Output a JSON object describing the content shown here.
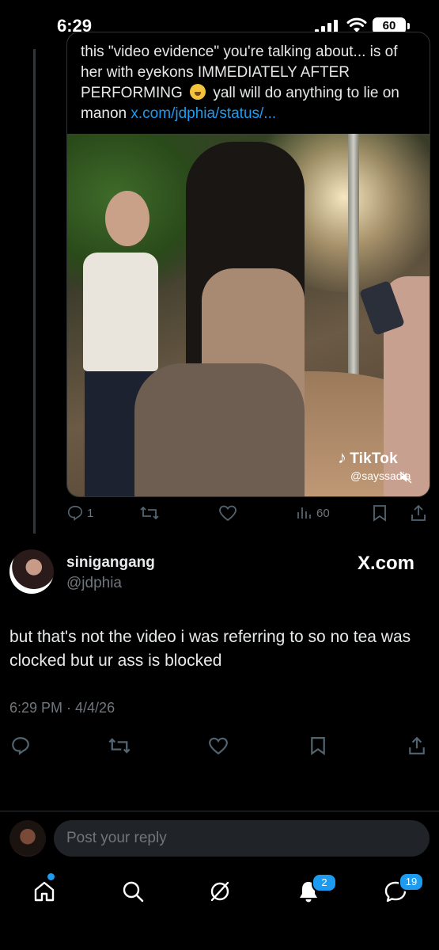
{
  "status_bar": {
    "time": "6:29",
    "battery": "60"
  },
  "quoted_tweet": {
    "text_before_emoji": "this \"video evidence\" you're talking about... is of her with eyekons IMMEDIATELY AFTER PERFORMING",
    "text_after_emoji": "yall will do anything to lie on manon",
    "link": "x.com/jdphia/status/...",
    "media": {
      "watermark": "TikTok",
      "watermark_handle": "@sayssadia"
    },
    "actions": {
      "reply_count": "1",
      "retweet_count": "",
      "like_count": "",
      "views_count": "60"
    }
  },
  "tweet": {
    "display_name": "sinigangang",
    "handle": "@jdphia",
    "source_badge": "X.com",
    "text": "but that's not the video i was referring to so no tea was clocked but ur ass is blocked",
    "timestamp": "6:29 PM · 4/4/26"
  },
  "reply": {
    "placeholder": "Post your reply"
  },
  "nav": {
    "notifications_badge": "2",
    "messages_badge": "19"
  },
  "colors": {
    "accent": "#1d9bf0",
    "muted": "#71767b",
    "text": "#e7e9ea",
    "background": "#000000"
  }
}
